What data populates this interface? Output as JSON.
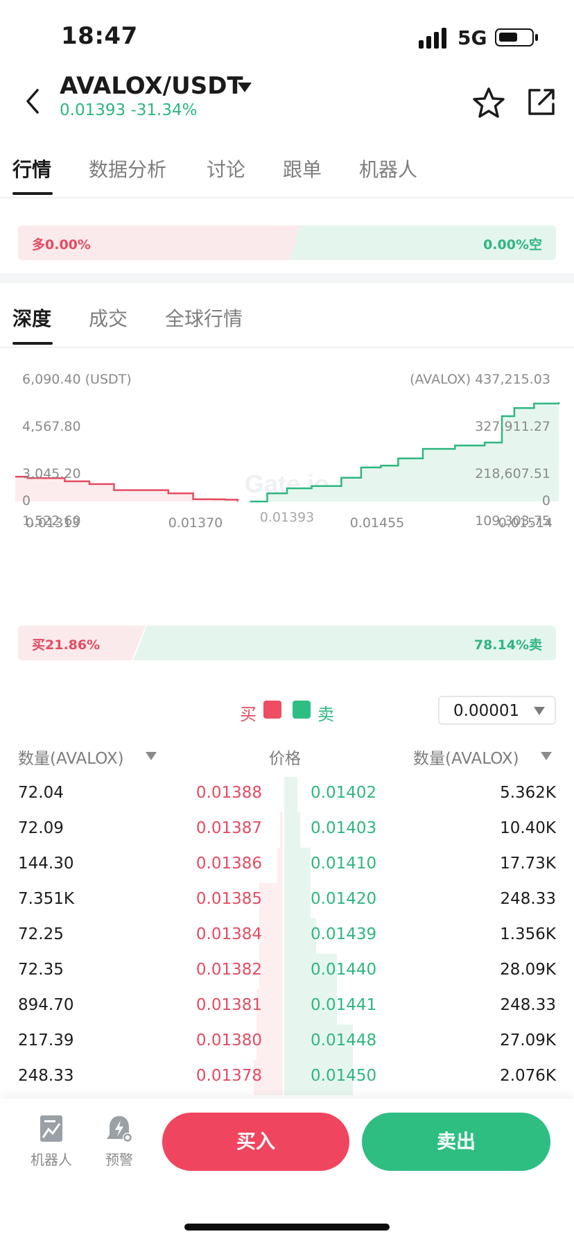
{
  "status": {
    "time": "18:47",
    "network": "5G"
  },
  "header": {
    "pair": "AVALOX/USDT",
    "last_price": "0.01393",
    "change": "-31.34%",
    "icons": [
      "back-arrow-icon",
      "caret-down-icon",
      "star-icon",
      "share-icon"
    ]
  },
  "main_tabs": [
    "行情",
    "数据分析",
    "讨论",
    "跟单",
    "机器人"
  ],
  "long_short": {
    "long": "多0.00%",
    "short": "0.00%空"
  },
  "sub_tabs": [
    "深度",
    "成交",
    "全球行情"
  ],
  "chart_data": {
    "type": "area",
    "y_left_labels": [
      "6,090.40 (USDT)",
      "4,567.80",
      "3,045.20",
      "1,522.60",
      "0"
    ],
    "y_right_labels": [
      "(AVALOX) 437,215.03",
      "327,911.27",
      "218,607.51",
      "109,303.75",
      "0"
    ],
    "x_labels": [
      "0.01313",
      "0.01370",
      "0.01393",
      "0.01455",
      "0.01514"
    ],
    "watermark": "Gate.io",
    "y_left_max": 6090.4,
    "y_right_max": 437215.03,
    "bids": {
      "name": "买",
      "price": [
        0.013,
        0.01305,
        0.01312,
        0.0132,
        0.0133,
        0.0134,
        0.01352,
        0.01362,
        0.01372,
        0.0138,
        0.01385,
        0.0139
      ],
      "depth_usdt": [
        1522,
        1440,
        1430,
        1240,
        1070,
        700,
        700,
        500,
        140,
        130,
        110,
        0
      ]
    },
    "asks": {
      "name": "卖",
      "price": [
        0.01395,
        0.01402,
        0.0141,
        0.0142,
        0.01432,
        0.0144,
        0.01448,
        0.01455,
        0.01465,
        0.01478,
        0.0149,
        0.01497,
        0.01502,
        0.0151,
        0.0152
      ],
      "depth_avalox": [
        0,
        36000,
        58000,
        68000,
        105000,
        150000,
        158000,
        190000,
        232000,
        247000,
        260000,
        376000,
        412000,
        432000,
        437215
      ]
    },
    "colors": {
      "bid": "#e54b62",
      "ask": "#2eb67f"
    }
  },
  "buy_sell_ratio": {
    "buy": "买21.86%",
    "sell": "78.14%卖",
    "buy_fraction": 0.2186
  },
  "orderbook": {
    "legend_buy": "买",
    "legend_sell": "卖",
    "precision": "0.00001",
    "col_left": "数量(AVALOX)",
    "col_mid": "价格",
    "col_right": "数量(AVALOX)",
    "rows": [
      {
        "bid_qty": "72.04",
        "bid_price": "0.01388",
        "ask_price": "0.01402",
        "ask_qty": "5.362K",
        "bid_depth": 0.0,
        "ask_depth": 0.05
      },
      {
        "bid_qty": "72.09",
        "bid_price": "0.01387",
        "ask_price": "0.01403",
        "ask_qty": "10.40K",
        "bid_depth": 0.01,
        "ask_depth": 0.06
      },
      {
        "bid_qty": "144.30",
        "bid_price": "0.01386",
        "ask_price": "0.01410",
        "ask_qty": "17.73K",
        "bid_depth": 0.02,
        "ask_depth": 0.1
      },
      {
        "bid_qty": "7.351K",
        "bid_price": "0.01385",
        "ask_price": "0.01420",
        "ask_qty": "248.33",
        "bid_depth": 0.09,
        "ask_depth": 0.1
      },
      {
        "bid_qty": "72.25",
        "bid_price": "0.01384",
        "ask_price": "0.01439",
        "ask_qty": "1.356K",
        "bid_depth": 0.09,
        "ask_depth": 0.12
      },
      {
        "bid_qty": "72.35",
        "bid_price": "0.01382",
        "ask_price": "0.01440",
        "ask_qty": "28.09K",
        "bid_depth": 0.09,
        "ask_depth": 0.2
      },
      {
        "bid_qty": "894.70",
        "bid_price": "0.01381",
        "ask_price": "0.01441",
        "ask_qty": "248.33",
        "bid_depth": 0.1,
        "ask_depth": 0.2
      },
      {
        "bid_qty": "217.39",
        "bid_price": "0.01380",
        "ask_price": "0.01448",
        "ask_qty": "27.09K",
        "bid_depth": 0.1,
        "ask_depth": 0.26
      },
      {
        "bid_qty": "248.33",
        "bid_price": "0.01378",
        "ask_price": "0.01450",
        "ask_qty": "2.076K",
        "bid_depth": 0.11,
        "ask_depth": 0.26
      }
    ]
  },
  "bottom": {
    "robot_label": "机器人",
    "alert_label": "预警",
    "buy_label": "买入",
    "sell_label": "卖出"
  }
}
